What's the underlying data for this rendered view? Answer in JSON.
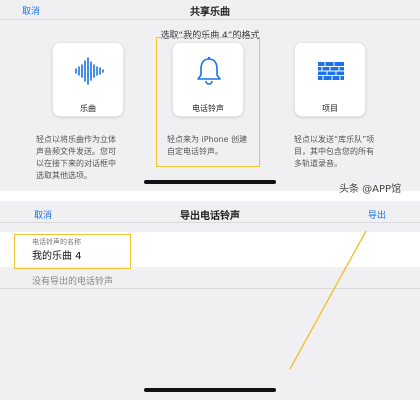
{
  "top": {
    "cancel_label": "取消",
    "title": "共享乐曲",
    "subtitle": "选取“我的乐曲 4”的格式",
    "options": [
      {
        "label": "乐曲",
        "icon": "waveform-icon",
        "description": "轻点以将乐曲作为立体声音频文件发送。您可以在接下来的对话框中选取其他选项。"
      },
      {
        "label": "电话铃声",
        "icon": "bell-icon",
        "description": "轻点来为 iPhone 创建自定电话铃声。"
      },
      {
        "label": "项目",
        "icon": "project-grid-icon",
        "description": "轻点以发送“库乐队”项目，其中包含您的所有多轨道录音。"
      }
    ]
  },
  "bottom": {
    "cancel_label": "取消",
    "title": "导出电话铃声",
    "export_label": "导出",
    "field_label": "电话铃声的名称",
    "field_value": "我的乐曲 4",
    "empty_note": "没有导出的电话铃声"
  },
  "watermark": "头条 @APP馆",
  "colors": {
    "accent": "#1a73e8",
    "highlight": "#f1c232",
    "icon_blue": "#1a73e8"
  }
}
